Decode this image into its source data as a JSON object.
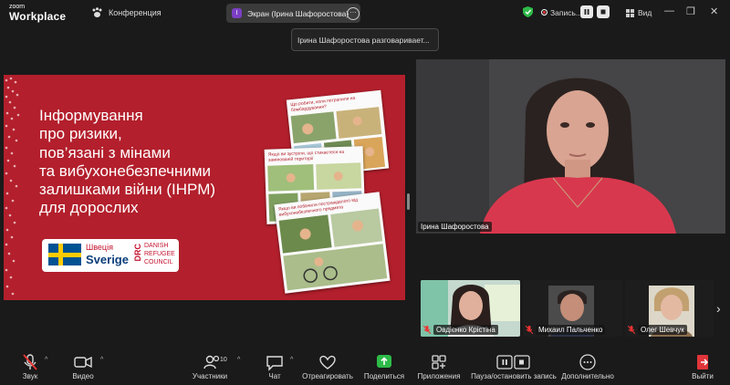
{
  "app": {
    "logo_line1": "zoom",
    "logo_line2": "Workplace"
  },
  "header": {
    "meeting_label": "Конференция",
    "share_badge": "I",
    "share_label": "Экран (Ірина Шафоростова)",
    "speaking_tooltip": "Ірина Шафоростова разговаривает...",
    "recording_label": "Запись...",
    "view_label": "Вид"
  },
  "slide": {
    "title_lines": [
      "Інформування",
      "про ризики,",
      "пов’язані з мінами",
      "та вибухонебезпечними",
      "залишками війни (ІНРМ)",
      "для дорослих"
    ],
    "sweden_small": "Швеція",
    "sweden_big": "Sverige",
    "drc_mark": "DRC",
    "drc_lines": [
      "DANISH",
      "REFUGEE",
      "COUNCIL"
    ],
    "comic_captions": [
      "Що робити, коли потрапили на бомбардування?",
      "Якщо ви зустріли, що стикаєтеся на замінованій території",
      "Якщо ви побачили постраждалого від вибухонебезпечного предмета"
    ]
  },
  "speaker": {
    "name": "Ірина Шафоростова"
  },
  "participants": [
    {
      "name": "Овдієнко Крістіна"
    },
    {
      "name": "Михаил Пальченко"
    },
    {
      "name": "Олег Шевчук"
    }
  ],
  "toolbar": {
    "audio": "Звук",
    "video": "Видео",
    "participants": "Участники",
    "participants_count": "10",
    "chat": "Чат",
    "react": "Отреагировать",
    "share": "Поделиться",
    "apps": "Приложения",
    "pause_record": "Пауза/остановить запись",
    "more": "Дополнительно",
    "leave": "Выйти"
  },
  "colors": {
    "slide_bg": "#b31f2c",
    "share_green": "#2dbb48",
    "leave_red": "#e0353a"
  }
}
